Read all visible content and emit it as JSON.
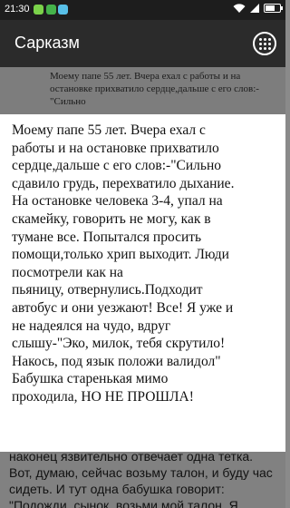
{
  "status_bar": {
    "time": "21:30",
    "left_icons": [
      "notification-icon",
      "notification-icon",
      "notification-icon"
    ],
    "right_icons": [
      "wifi-icon",
      "signal-icon",
      "battery-icon"
    ]
  },
  "toolbar": {
    "title": "Сарказм",
    "menu_icon": "grid-menu-icon"
  },
  "background": {
    "list_item_text": "Моему папе 55 лет. Вчера ехал с работы и на остановке прихватило сердце,дальше с его слов:-\"Сильно",
    "body_text": "наконец язвительно отвечает одна тетка. Вот, думаю, сейчас возьму талон, и буду час сидеть. И тут одна бабушка говорит: \"Подожди, сынок, возьми мой талон. Я"
  },
  "popup": {
    "text": "Моему папе 55 лет. Вчера ехал с\nработы и на остановке прихватило\nсердце,дальше с его слов:-\"Сильно\nсдавило грудь, перехватило дыхание.\nНа остановке человека 3-4, упал на\nскамейку, говорить не могу, как в\nтумане все. Попытался просить\nпомощи,только хрип выходит. Люди\nпосмотрели как на\nпьяницу, отвернулись.Подходит\nавтобус и они уезжают! Все! Я уже и\nне надеялся на чудо, вдруг\nслышу-\"Эко, милок, тебя скрутило!\nНакось, под язык положи валидол\"\nБабушка старенькая мимо\nпроходила, НО НЕ ПРОШЛА!"
  }
}
